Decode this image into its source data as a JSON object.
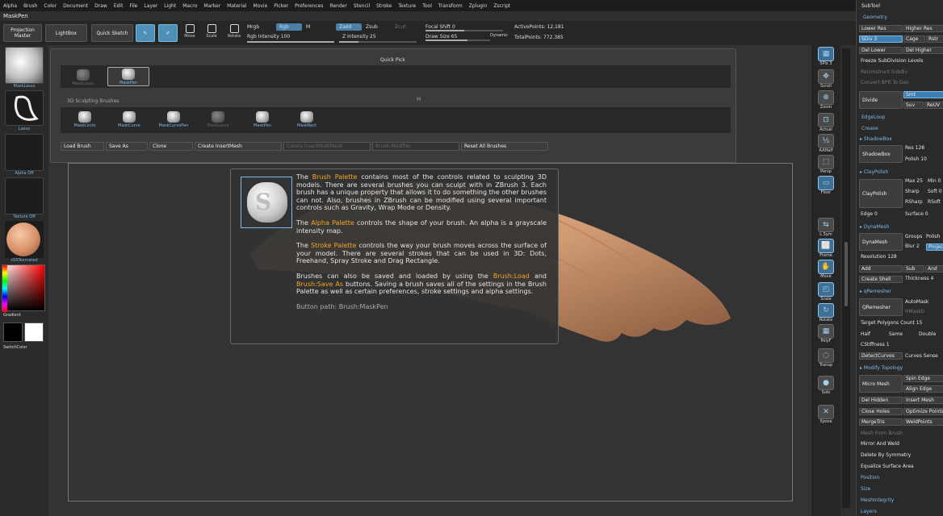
{
  "menu": [
    "Alpha",
    "Brush",
    "Color",
    "Document",
    "Draw",
    "Edit",
    "File",
    "Layer",
    "Light",
    "Macro",
    "Marker",
    "Material",
    "Movie",
    "Picker",
    "Preferences",
    "Render",
    "Stencil",
    "Stroke",
    "Texture",
    "Tool",
    "Transform",
    "Zplugin",
    "Zscript"
  ],
  "brush_name": "MaskPen",
  "toolbar": {
    "projection_master": "Projection Master",
    "lightbox": "LightBox",
    "quick_sketch": "Quick Sketch",
    "move": "Move",
    "scale": "Scale",
    "rotate": "Rotate",
    "mrgb": "Mrgb",
    "rgb": "Rgb",
    "m": "M",
    "rgb_intensity": "Rgb Intensity 100",
    "zadd": "Zadd",
    "zsub": "Zsub",
    "zcut": "Zcut",
    "z_intensity": "Z Intensity 25",
    "focal_shift": "Focal Shift 0",
    "draw_size": "Draw Size 65",
    "dynamic": "Dynamic",
    "active_points": "ActivePoints: 12,181",
    "total_points": "TotalPoints: 772,385"
  },
  "left_shelf": {
    "brush_label": "MaskLasso",
    "stroke_label": "Lasso",
    "alpha_label": "Alpha Off",
    "texture_label": "Texture Off",
    "material_label": "zSSTexmated",
    "gradient_label": "Gradient",
    "switchcolor_label": "SwitchColor"
  },
  "quickpick": {
    "title": "Quick Pick",
    "quick_slots": [
      "MaskLasso",
      "MaskPen"
    ],
    "section": "3D Sculpting Brushes",
    "section_marker": "M",
    "brushes": [
      "MaskCircle",
      "MaskCurve",
      "MaskCurvePen",
      "MaskLasso",
      "MaskPen",
      "MaskRect"
    ],
    "buttons": [
      "Load Brush",
      "Save As",
      "Clone",
      "Create InsertMesh",
      "Create InsertMultiMesh",
      "Brush Modifier",
      "Reset All Brushes"
    ]
  },
  "tooltip": {
    "p1_a": "The ",
    "p1_hl1": "Brush Palette",
    "p1_b": " contains most of the controls related to sculpting 3D models. There are several brushes you can sculpt with in ZBrush 3. Each brush has a unique property that allows it to do something the other brushes can not. Also, brushes in ZBrush can be modified using several important controls such as Gravity, Wrap Mode or Density.",
    "p2_a": "The ",
    "p2_hl": "Alpha Palette",
    "p2_b": " controls the shape of your brush. An alpha is a grayscale intensity map.",
    "p3_a": "The ",
    "p3_hl": "Stroke Palette",
    "p3_b": " controls the way your brush moves across the surface of your model. There are several strokes that can be used in 3D: Dots, Freehand, Spray Stroke and Drag Rectangle.",
    "p4_a": "Brushes can also be saved and loaded by using the ",
    "p4_hl1": "Brush:Load",
    "p4_b": " and ",
    "p4_hl2": "Brush:Save As",
    "p4_c": " buttons. Saving a brush saves all of the settings in the Brush Palette as well as certain preferences, stroke settings and alpha settings.",
    "path": "Button path: Brush:MaskPen",
    "icon_letter": "S"
  },
  "right_shelf": [
    "SPix 3",
    "Scroll",
    "Zoom",
    "Actual",
    "AAHalf",
    "Persp",
    "Floor",
    "L.Sym",
    "Frame",
    "Move",
    "Scale",
    "Rotate",
    "PolyF",
    "Transp",
    "Solo",
    "Xpose"
  ],
  "right_shelf_glyphs": [
    "▦",
    "✥",
    "⊕",
    "⊡",
    "½",
    "⬚",
    "▭",
    "⇆",
    "⬜",
    "✋",
    "◰",
    "↻",
    "▦",
    "◌",
    "●",
    "✕"
  ],
  "subtool": {
    "title": "SubTool",
    "geometry": "Geometry",
    "lower_res": "Lower Res",
    "higher_res": "Higher Res",
    "sdiv": "SDiv 3",
    "cage": "Cage",
    "rstr": "Rstr",
    "del_lower": "Del Lower",
    "del_higher": "Del Higher",
    "freeze": "Freeze SubDivision Levels",
    "reconstruct": "Reconstruct Subdiv",
    "convert_bpr": "Convert BPR To Geo",
    "divide": "Divide",
    "smt": "Smt",
    "suv": "Suv",
    "reuv": "ReUV",
    "edgeloop": "EdgeLoop",
    "crease": "Crease",
    "shadowbox_head": "ShadowBox",
    "shadowbox": "ShadowBox",
    "res": "Res 128",
    "polish": "Polish 10",
    "claypolish_head": "ClayPolish",
    "claypolish": "ClayPolish",
    "max": "Max 25",
    "min": "Min 0",
    "sharp": "Sharp",
    "soft": "Soft 0",
    "rsharp": "RSharp",
    "rsoft": "RSoft",
    "edge": "Edge 0",
    "surface": "Surface 0",
    "dynamesh_head": "DynaMesh",
    "dynamesh": "DynaMesh",
    "groups": "Groups",
    "polish2": "Polish",
    "blur": "Blur 2",
    "project": "Project",
    "resolution": "Resolution 128",
    "add": "Add",
    "sub": "Sub",
    "and": "And",
    "create_shell": "Create Shell",
    "thickness": "Thickness 4",
    "qremesher_head": "qRemesher",
    "qremesher": "QRemesher",
    "automask": "AutoMask",
    "halfmask": "HMaskb",
    "target_polygons": "Target Polygons Count 15",
    "half": "Half",
    "same": "Same",
    "double": "Double",
    "adapt": "Adapt",
    "cstiffness": "CStiffness 1",
    "detect_curves": "DetectCurves",
    "curves_sense": "Curves Sense",
    "modify_topology": "Modify Topology",
    "micro_mesh": "Micro Mesh",
    "spin_edge": "Spin Edge",
    "align_edge": "Align Edge",
    "del_hidden": "Del Hidden",
    "insert_mesh": "Insert Mesh",
    "close_holes": "Close Holes",
    "optimize_points": "Optimize Points",
    "merge_tris": "MergeTris",
    "weld_points": "WeldPoints",
    "mesh_from_brush": "Mesh From Brush",
    "mirror_weld": "Mirror And Weld",
    "delete_symmetry": "Delete By Symmetry",
    "equalize": "Equalize Surface Area",
    "position": "Position",
    "size": "Size",
    "mesh_integrity": "MeshIntegrity",
    "layers": "Layers"
  }
}
